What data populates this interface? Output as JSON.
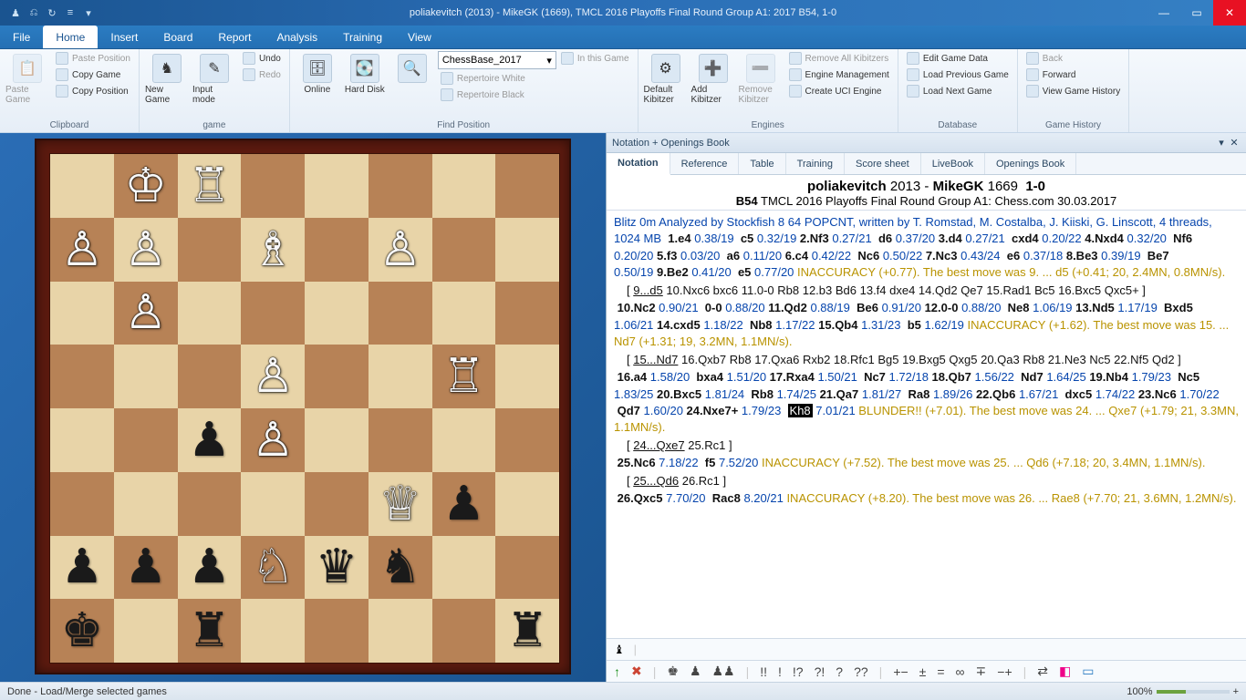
{
  "title": "poliakevitch (2013) - MikeGK (1669), TMCL 2016 Playoffs Final Round Group A1: 2017  B54, 1-0",
  "menu": {
    "tabs": [
      "File",
      "Home",
      "Insert",
      "Board",
      "Report",
      "Analysis",
      "Training",
      "View"
    ],
    "active": 1
  },
  "ribbon": {
    "clipboard": {
      "paste": "Paste Game",
      "items": [
        "Paste Position",
        "Copy Game",
        "Copy Position"
      ],
      "label": "Clipboard"
    },
    "game": {
      "new": "New Game",
      "input": "Input mode",
      "undo": "Undo",
      "redo": "Redo",
      "label": "game"
    },
    "findpos": {
      "online": "Online",
      "hard": "Hard Disk",
      "combo": "ChessBase_2017",
      "inthis": "In this Game",
      "repw": "Repertoire White",
      "repb": "Repertoire Black",
      "label": "Find Position"
    },
    "engines": {
      "def": "Default Kibitzer",
      "add": "Add Kibitzer",
      "rem": "Remove Kibitzer",
      "removeall": "Remove All Kibitzers",
      "mgmt": "Engine Management",
      "uci": "Create UCI Engine",
      "label": "Engines"
    },
    "database": {
      "edit": "Edit Game Data",
      "prev": "Load Previous Game",
      "next": "Load Next Game",
      "label": "Database"
    },
    "history": {
      "back": "Back",
      "fwd": "Forward",
      "view": "View Game History",
      "label": "Game History"
    }
  },
  "notation_pane": {
    "title": "Notation + Openings Book",
    "tabs": [
      "Notation",
      "Reference",
      "Table",
      "Training",
      "Score sheet",
      "LiveBook",
      "Openings Book"
    ],
    "active": 0,
    "players_html": [
      "poliakevitch",
      "2013",
      "MikeGK",
      "1669",
      "1-0"
    ],
    "event": [
      "B54",
      "TMCL 2016 Playoffs Final Round Group A1: Chess.com 30.03.2017"
    ]
  },
  "status": {
    "left": "Done - Load/Merge selected games",
    "zoom": "100%"
  },
  "chart_data": {
    "type": "table",
    "title": "Chess position (FEN-like, white on top as displayed)",
    "board_rows_top_to_bottom": [
      ". K R . . . . .",
      "P P . B . P . .",
      ". P . . . . . .",
      ". . . P . . R .",
      ". . p P . . . .",
      ". . . . . Q p .",
      "p p p N q n . .",
      "k . r . . . . r"
    ],
    "legend": "Uppercase=White, lowercase=Black, .=empty",
    "move_list": [
      {
        "no": 1,
        "w": "e4",
        "we": "0.38/19",
        "b": "c5",
        "be": "0.32/19"
      },
      {
        "no": 2,
        "w": "Nf3",
        "we": "0.27/21",
        "b": "d6",
        "be": "0.37/20"
      },
      {
        "no": 3,
        "w": "d4",
        "we": "0.27/21",
        "b": "cxd4",
        "be": "0.20/22"
      },
      {
        "no": 4,
        "w": "Nxd4",
        "we": "0.32/20",
        "b": "Nf6",
        "be": "0.20/20"
      },
      {
        "no": 5,
        "w": "f3",
        "we": "0.03/20",
        "b": "a6",
        "be": "0.11/20"
      },
      {
        "no": 6,
        "w": "c4",
        "we": "0.42/22",
        "b": "Nc6",
        "be": "0.50/22"
      },
      {
        "no": 7,
        "w": "Nc3",
        "we": "0.43/24",
        "b": "e6",
        "be": "0.37/18"
      },
      {
        "no": 8,
        "w": "Be3",
        "we": "0.39/19",
        "b": "Be7",
        "be": "0.50/19"
      },
      {
        "no": 9,
        "w": "Be2",
        "we": "0.41/20",
        "b": "e5",
        "be": "0.77/20",
        "note": "INACCURACY (+0.77). The best move was 9. ... d5 (+0.41; 20, 2.4MN, 0.8MN/s)."
      },
      {
        "no": 10,
        "w": "Nc2",
        "we": "0.90/21",
        "b": "0-0",
        "be": "0.88/20"
      },
      {
        "no": 11,
        "w": "Qd2",
        "we": "0.88/19",
        "b": "Be6",
        "be": "0.91/20"
      },
      {
        "no": 12,
        "w": "0-0",
        "we": "0.88/20",
        "b": "Ne8",
        "be": "1.06/19"
      },
      {
        "no": 13,
        "w": "Nd5",
        "we": "1.17/19",
        "b": "Bxd5",
        "be": "1.06/21"
      },
      {
        "no": 14,
        "w": "cxd5",
        "we": "1.18/22",
        "b": "Nb8",
        "be": "1.17/22"
      },
      {
        "no": 15,
        "w": "Qb4",
        "we": "1.31/23",
        "b": "b5",
        "be": "1.62/19",
        "note": "INACCURACY (+1.62). The best move was 15. ... Nd7 (+1.31; 19, 3.2MN, 1.1MN/s)."
      },
      {
        "no": 16,
        "w": "a4",
        "we": "1.58/20",
        "b": "bxa4",
        "be": "1.51/20"
      },
      {
        "no": 17,
        "w": "Rxa4",
        "we": "1.50/21",
        "b": "Nc7",
        "be": "1.72/18"
      },
      {
        "no": 18,
        "w": "Qb7",
        "we": "1.56/22",
        "b": "Nd7",
        "be": "1.64/25"
      },
      {
        "no": 19,
        "w": "Nb4",
        "we": "1.79/23",
        "b": "Nc5",
        "be": "1.83/25"
      },
      {
        "no": 20,
        "w": "Bxc5",
        "we": "1.81/24",
        "b": "Rb8",
        "be": "1.74/25"
      },
      {
        "no": 21,
        "w": "Qa7",
        "we": "1.81/27",
        "b": "Ra8",
        "be": "1.89/26"
      },
      {
        "no": 22,
        "w": "Qb6",
        "we": "1.67/21",
        "b": "dxc5",
        "be": "1.74/22"
      },
      {
        "no": 23,
        "w": "Nc6",
        "we": "1.70/22",
        "b": "Qd7",
        "be": "1.60/20"
      },
      {
        "no": 24,
        "w": "Nxe7+",
        "we": "1.79/23",
        "b": "Kh8",
        "be": "7.01/21",
        "note": "BLUNDER!! (+7.01). The best move was 24. ... Qxe7 (+1.79; 21, 3.3MN, 1.1MN/s)."
      },
      {
        "no": 25,
        "w": "Nc6",
        "we": "7.18/22",
        "b": "f5",
        "be": "7.52/20",
        "note": "INACCURACY (+7.52). The best move was 25. ... Qd6 (+7.18; 20, 3.4MN, 1.1MN/s)."
      },
      {
        "no": 26,
        "w": "Qxc5",
        "we": "7.70/20",
        "b": "Rac8",
        "be": "8.20/21",
        "note": "INACCURACY (+8.20). The best move was 26. ... Rae8 (+7.70; 21, 3.6MN, 1.2MN/s)."
      }
    ],
    "variations": [
      {
        "after": "9...e5",
        "line": "9...d5 10.Nxc6 bxc6 11.0-0 Rb8 12.b3 Bd6 13.f4 dxe4 14.Qd2 Qe7 15.Rad1 Bc5 16.Bxc5 Qxc5+"
      },
      {
        "after": "15...b5",
        "line": "15...Nd7 16.Qxb7 Rb8 17.Qxa6 Rxb2 18.Rfc1 Bg5 19.Bxg5 Qxg5 20.Qa3 Rb8 21.Ne3 Nc5 22.Nf5 Qd2"
      },
      {
        "after": "24...Kh8",
        "line": "24...Qxe7 25.Rc1"
      },
      {
        "after": "25...f5",
        "line": "25...Qd6 26.Rc1"
      }
    ],
    "engine_header": "Blitz 0m Analyzed by Stockfish 8 64 POPCNT, written by T. Romstad, M. Costalba, J. Kiiski, G. Linscott, 4 threads, 1024 MB"
  }
}
